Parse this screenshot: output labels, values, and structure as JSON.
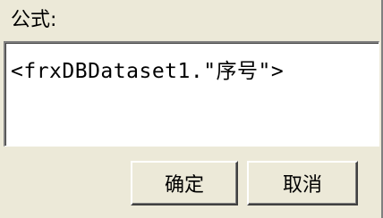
{
  "formula": {
    "label": "公式:",
    "value": "<frxDBDataset1.\"序号\">"
  },
  "buttons": {
    "ok_label": "确定",
    "cancel_label": "取消"
  }
}
